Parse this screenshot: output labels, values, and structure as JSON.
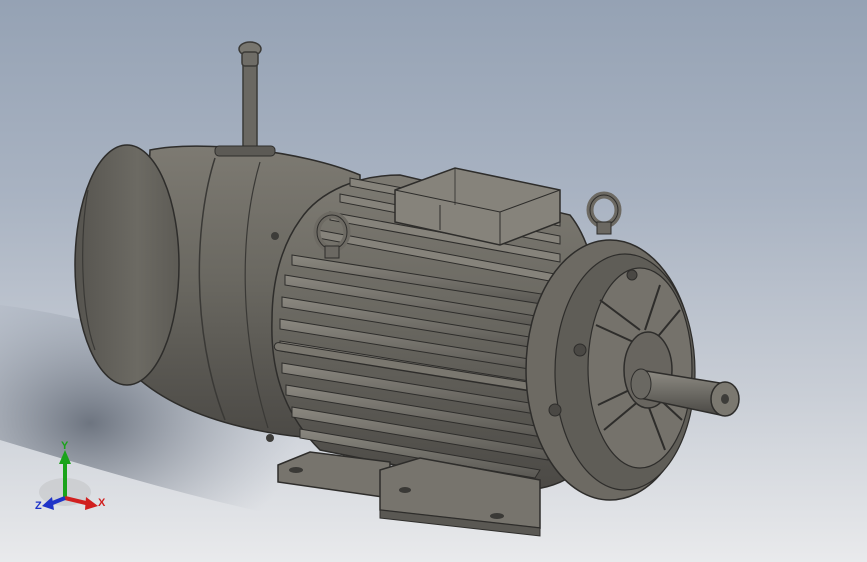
{
  "viewport": {
    "background_top": "#95a2b4",
    "background_bottom": "#e9eaec",
    "model_name": "motor-with-brake-release-lever"
  },
  "triad": {
    "x_label": "X",
    "y_label": "Y",
    "z_label": "Z",
    "x_color": "#d11f1f",
    "y_color": "#1aa31a",
    "z_color": "#1f33c8"
  }
}
